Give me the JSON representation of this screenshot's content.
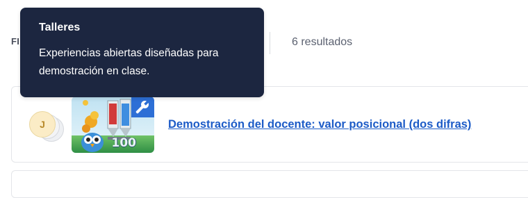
{
  "filter": {
    "label": "FI"
  },
  "results": {
    "count_text": "6 resultados"
  },
  "tooltip": {
    "title": "Talleres",
    "body": "Experiencias abiertas diseñadas para demostración en clase."
  },
  "activity": {
    "avatar_initial": "J",
    "thumbnail_icon": "wrench-icon",
    "thumbnail_score": "100",
    "title": "Demostración del docente: valor posicional (dos difras)"
  },
  "colors": {
    "tooltip_bg": "#1c2640",
    "link": "#1c5bc7",
    "badge_blue": "#2d6fd6",
    "avatar_bg": "#fbecc6"
  }
}
